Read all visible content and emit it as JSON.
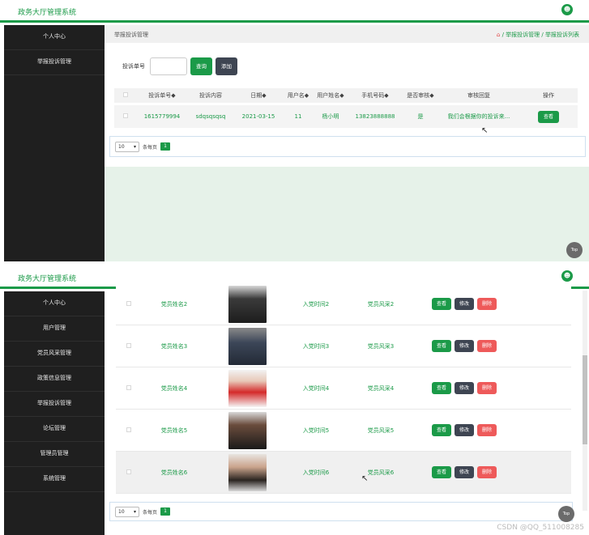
{
  "app": {
    "title": "政务大厅管理系统"
  },
  "screen1": {
    "sidebar": [
      "个人中心",
      "举报投诉管理"
    ],
    "breadcrumb": {
      "title": "举报投诉管理",
      "path": "/ 举报投诉管理 / 举报投诉列表"
    },
    "filter": {
      "label": "投诉单号",
      "search": "查询",
      "add": "添加"
    },
    "table": {
      "headers": [
        "投诉单号◆",
        "投诉内容",
        "日期◆",
        "用户名◆",
        "用户姓名◆",
        "手机号码◆",
        "是否审核◆",
        "审核回复",
        "操作"
      ],
      "rows": [
        [
          "1615779994",
          "sdqsqsqsq",
          "2021-03-15",
          "11",
          "杨小明",
          "13823888888",
          "是",
          "我们会根据你的投诉来...",
          "查看"
        ]
      ]
    },
    "pager": {
      "size": "10",
      "label": "条每页",
      "page": "1"
    },
    "top_label": "Top"
  },
  "screen2": {
    "sidebar": [
      "个人中心",
      "用户管理",
      "党员风采管理",
      "政策信息管理",
      "举报投诉管理",
      "论坛管理",
      "管理员管理",
      "系统管理"
    ],
    "rows": [
      {
        "name": "党员姓名2",
        "time": "入党时间2",
        "style": "党员风采2"
      },
      {
        "name": "党员姓名3",
        "time": "入党时间3",
        "style": "党员风采3"
      },
      {
        "name": "党员姓名4",
        "time": "入党时间4",
        "style": "党员风采4"
      },
      {
        "name": "党员姓名5",
        "time": "入党时间5",
        "style": "党员风采5"
      },
      {
        "name": "党员姓名6",
        "time": "入党时间6",
        "style": "党员风采6"
      }
    ],
    "ops": {
      "view": "查看",
      "edit": "修改",
      "delete": "删除"
    },
    "pager": {
      "size": "10",
      "label": "条每页",
      "page": "1"
    },
    "top_label": "Top"
  },
  "watermark": "CSDN @QQ_511008285",
  "colors": {
    "brand": "#1b9a48",
    "sidebar": "#1f1f1f",
    "danger": "#ee5a5a",
    "dark": "#3e4552"
  }
}
